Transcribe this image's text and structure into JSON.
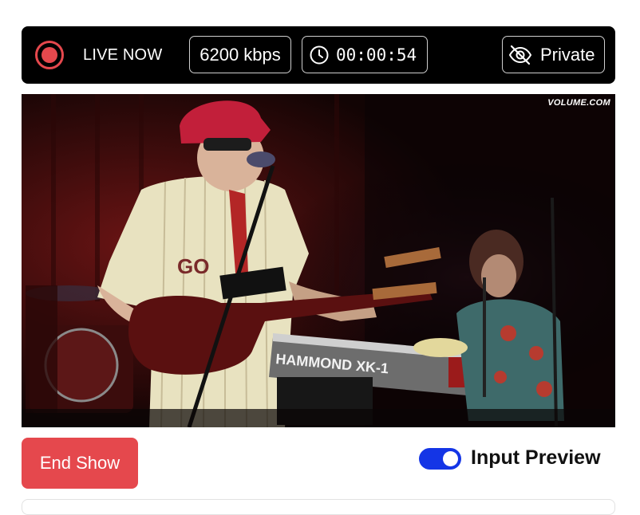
{
  "status_bar": {
    "live_label": "LIVE NOW",
    "bitrate": "6200 kbps",
    "elapsed_time": "00:00:54",
    "privacy_label": "Private"
  },
  "video": {
    "watermark": "VOLUME.COM"
  },
  "controls": {
    "end_show_label": "End Show",
    "input_preview_label": "Input Preview",
    "input_preview_enabled": true
  },
  "colors": {
    "live_red": "#e5484d",
    "toggle_blue": "#1435e6",
    "bar_background": "#000000"
  }
}
